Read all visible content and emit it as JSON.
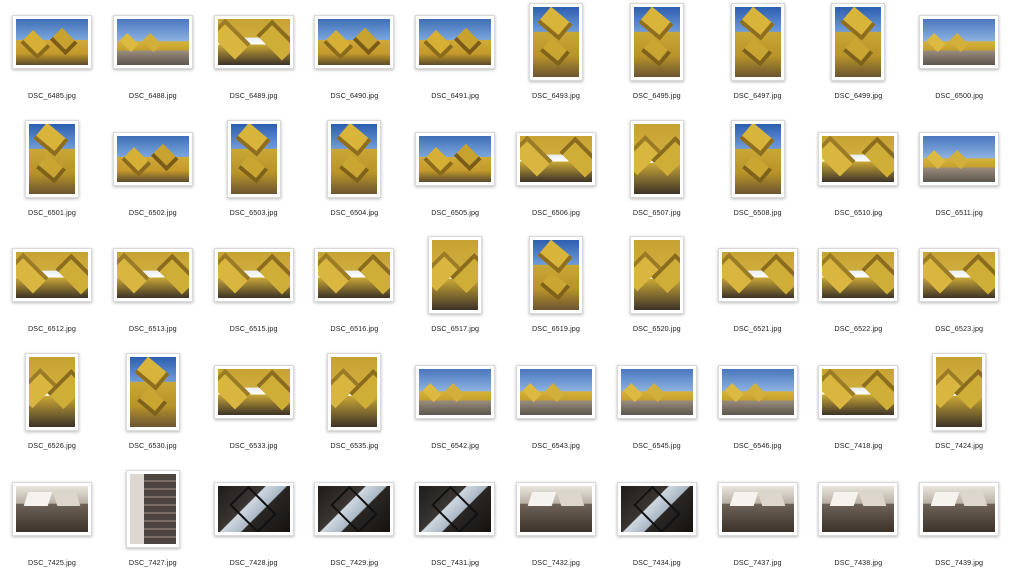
{
  "thumbnails": [
    {
      "name": "DSC_6485.jpg",
      "orientation": "landscape",
      "style": "sky"
    },
    {
      "name": "DSC_6488.jpg",
      "orientation": "landscape",
      "style": "street"
    },
    {
      "name": "DSC_6489.jpg",
      "orientation": "landscape",
      "style": "under"
    },
    {
      "name": "DSC_6490.jpg",
      "orientation": "landscape",
      "style": "sky"
    },
    {
      "name": "DSC_6491.jpg",
      "orientation": "landscape",
      "style": "sky"
    },
    {
      "name": "DSC_6493.jpg",
      "orientation": "portrait",
      "style": "tower"
    },
    {
      "name": "DSC_6495.jpg",
      "orientation": "portrait",
      "style": "tower"
    },
    {
      "name": "DSC_6497.jpg",
      "orientation": "portrait",
      "style": "tower"
    },
    {
      "name": "DSC_6499.jpg",
      "orientation": "portrait",
      "style": "tower"
    },
    {
      "name": "DSC_6500.jpg",
      "orientation": "landscape",
      "style": "street"
    },
    {
      "name": "DSC_6501.jpg",
      "orientation": "portrait",
      "style": "tower"
    },
    {
      "name": "DSC_6502.jpg",
      "orientation": "landscape",
      "style": "sky"
    },
    {
      "name": "DSC_6503.jpg",
      "orientation": "portrait",
      "style": "tower"
    },
    {
      "name": "DSC_6504.jpg",
      "orientation": "portrait",
      "style": "tower"
    },
    {
      "name": "DSC_6505.jpg",
      "orientation": "landscape",
      "style": "sky"
    },
    {
      "name": "DSC_6506.jpg",
      "orientation": "landscape",
      "style": "under"
    },
    {
      "name": "DSC_6507.jpg",
      "orientation": "portrait",
      "style": "under"
    },
    {
      "name": "DSC_6508.jpg",
      "orientation": "portrait",
      "style": "tower"
    },
    {
      "name": "DSC_6510.jpg",
      "orientation": "landscape",
      "style": "under"
    },
    {
      "name": "DSC_6511.jpg",
      "orientation": "landscape",
      "style": "street"
    },
    {
      "name": "DSC_6512.jpg",
      "orientation": "landscape",
      "style": "under"
    },
    {
      "name": "DSC_6513.jpg",
      "orientation": "landscape",
      "style": "under"
    },
    {
      "name": "DSC_6515.jpg",
      "orientation": "landscape",
      "style": "under"
    },
    {
      "name": "DSC_6516.jpg",
      "orientation": "landscape",
      "style": "under"
    },
    {
      "name": "DSC_6517.jpg",
      "orientation": "portrait",
      "style": "under"
    },
    {
      "name": "DSC_6519.jpg",
      "orientation": "portrait",
      "style": "tower"
    },
    {
      "name": "DSC_6520.jpg",
      "orientation": "portrait",
      "style": "under"
    },
    {
      "name": "DSC_6521.jpg",
      "orientation": "landscape",
      "style": "under"
    },
    {
      "name": "DSC_6522.jpg",
      "orientation": "landscape",
      "style": "under"
    },
    {
      "name": "DSC_6523.jpg",
      "orientation": "landscape",
      "style": "under"
    },
    {
      "name": "DSC_6526.jpg",
      "orientation": "portrait",
      "style": "under"
    },
    {
      "name": "DSC_6530.jpg",
      "orientation": "portrait",
      "style": "tower"
    },
    {
      "name": "DSC_6533.jpg",
      "orientation": "landscape",
      "style": "under"
    },
    {
      "name": "DSC_6535.jpg",
      "orientation": "portrait",
      "style": "under"
    },
    {
      "name": "DSC_6542.jpg",
      "orientation": "landscape",
      "style": "street"
    },
    {
      "name": "DSC_6543.jpg",
      "orientation": "landscape",
      "style": "street"
    },
    {
      "name": "DSC_6545.jpg",
      "orientation": "landscape",
      "style": "street"
    },
    {
      "name": "DSC_6546.jpg",
      "orientation": "landscape",
      "style": "street"
    },
    {
      "name": "DSC_7418.jpg",
      "orientation": "landscape",
      "style": "under"
    },
    {
      "name": "DSC_7424.jpg",
      "orientation": "portrait",
      "style": "under"
    },
    {
      "name": "DSC_7425.jpg",
      "orientation": "landscape",
      "style": "interior"
    },
    {
      "name": "DSC_7427.jpg",
      "orientation": "portrait",
      "style": "stairs"
    },
    {
      "name": "DSC_7428.jpg",
      "orientation": "landscape",
      "style": "window"
    },
    {
      "name": "DSC_7429.jpg",
      "orientation": "landscape",
      "style": "window"
    },
    {
      "name": "DSC_7431.jpg",
      "orientation": "landscape",
      "style": "window"
    },
    {
      "name": "DSC_7432.jpg",
      "orientation": "landscape",
      "style": "interior"
    },
    {
      "name": "DSC_7434.jpg",
      "orientation": "landscape",
      "style": "window"
    },
    {
      "name": "DSC_7437.jpg",
      "orientation": "landscape",
      "style": "interior"
    },
    {
      "name": "DSC_7438.jpg",
      "orientation": "landscape",
      "style": "interior"
    },
    {
      "name": "DSC_7439.jpg",
      "orientation": "landscape",
      "style": "interior"
    }
  ]
}
